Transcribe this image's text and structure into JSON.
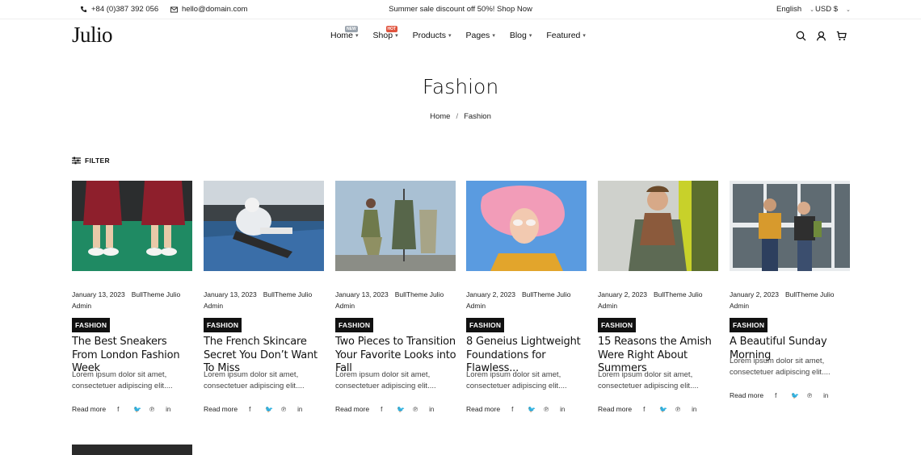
{
  "topbar": {
    "phone": "+84 (0)387 392 056",
    "email": "hello@domain.com",
    "promo": "Summer sale discount off 50%! Shop Now",
    "language": "English",
    "currency": "USD $"
  },
  "header": {
    "logo": "Julio",
    "nav": [
      {
        "label": "Home",
        "badge": "NEW",
        "badge_color": "#9aa3ad"
      },
      {
        "label": "Shop",
        "badge": "HOT",
        "badge_color": "#e0533d"
      },
      {
        "label": "Products"
      },
      {
        "label": "Pages"
      },
      {
        "label": "Blog"
      },
      {
        "label": "Featured"
      }
    ],
    "icons": [
      "search-icon",
      "user-icon",
      "cart-icon"
    ]
  },
  "page": {
    "title": "Fashion",
    "breadcrumb": [
      "Home",
      "Fashion"
    ],
    "filter_label": "FILTER"
  },
  "posts": [
    {
      "date": "January 13, 2023",
      "author": "BullTheme Julio Admin",
      "tag": "FASHION",
      "title": "The Best Sneakers From London Fashion Week",
      "excerpt": "Lorem ipsum dolor sit amet, consectetuer adipiscing elit....",
      "read_more": "Read more"
    },
    {
      "date": "January 13, 2023",
      "author": "BullTheme Julio Admin",
      "tag": "FASHION",
      "title": "The French Skincare Secret You Don’t Want To Miss",
      "excerpt": "Lorem ipsum dolor sit amet, consectetuer adipiscing elit....",
      "read_more": "Read more"
    },
    {
      "date": "January 13, 2023",
      "author": "BullTheme Julio Admin",
      "tag": "FASHION",
      "title": "Two Pieces to Transition Your Favorite Looks into Fall",
      "excerpt": "Lorem ipsum dolor sit amet, consectetuer adipiscing elit....",
      "read_more": "Read more"
    },
    {
      "date": "January 2, 2023",
      "author": "BullTheme Julio Admin",
      "tag": "FASHION",
      "title": "8 Geneius Lightweight Foundations for Flawless...",
      "excerpt": "Lorem ipsum dolor sit amet, consectetuer adipiscing elit....",
      "read_more": "Read more"
    },
    {
      "date": "January 2, 2023",
      "author": "BullTheme Julio Admin",
      "tag": "FASHION",
      "title": "15 Reasons the Amish Were Right About Summers",
      "excerpt": "Lorem ipsum dolor sit amet, consectetuer adipiscing elit....",
      "read_more": "Read more"
    },
    {
      "date": "January 2, 2023",
      "author": "BullTheme Julio Admin",
      "tag": "FASHION",
      "title": "A Beautiful Sunday Morning",
      "excerpt": "Lorem ipsum dolor sit amet, consectetuer adipiscing elit....",
      "read_more": "Read more"
    }
  ],
  "share_icons": [
    "facebook-icon",
    "twitter-icon",
    "pinterest-icon",
    "linkedin-icon"
  ],
  "share_glyphs": [
    "f",
    "🐦",
    "℗",
    "in"
  ]
}
